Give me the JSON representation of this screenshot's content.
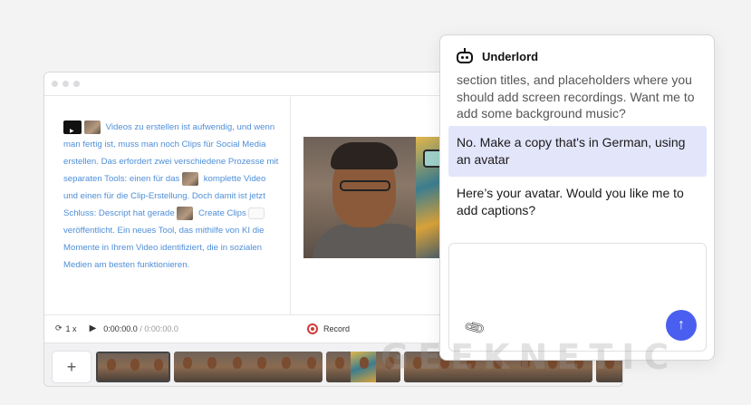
{
  "editor": {
    "script_text": "Videos zu erstellen ist aufwendig, und wenn man fertig ist, muss man noch Clips für Social Media erstellen. Das erfordert zwei verschiedene Prozesse mit separaten Tools: einen für das",
    "script_text_2": "komplette Video und einen für die Clip-Erstellung. Doch damit ist jetzt Schluss: Descript hat gerade",
    "script_text_3": "Create Clips",
    "script_text_4": "veröffentlicht. Ein neues Tool, das mithilfe von KI die Momente in Ihrem Video identifiziert, die in sozialen Medien am besten funktionieren.",
    "transport": {
      "speed": "1 x",
      "current_time": "0:00:00.0",
      "separator": "/",
      "total_time": "0:00:00.0",
      "record_label": "Record"
    },
    "timeline": {
      "add_label": "+"
    }
  },
  "chat": {
    "title": "Underlord",
    "messages": [
      {
        "role": "assistant",
        "text": "section titles, and placeholders where you should add screen recordings. Want me to add some background music?"
      },
      {
        "role": "user",
        "text": "No. Make a copy that's in German, using an avatar"
      },
      {
        "role": "assistant",
        "text": "Here’s your avatar. Would you like me to add captions?"
      }
    ],
    "composer_placeholder": "",
    "send_icon": "↑"
  },
  "watermark": "GEEKNETIC",
  "colors": {
    "accent": "#4a5ff0",
    "script_text": "#4f8fd8",
    "user_bubble": "#e3e5fb",
    "record": "#d23a3a"
  }
}
